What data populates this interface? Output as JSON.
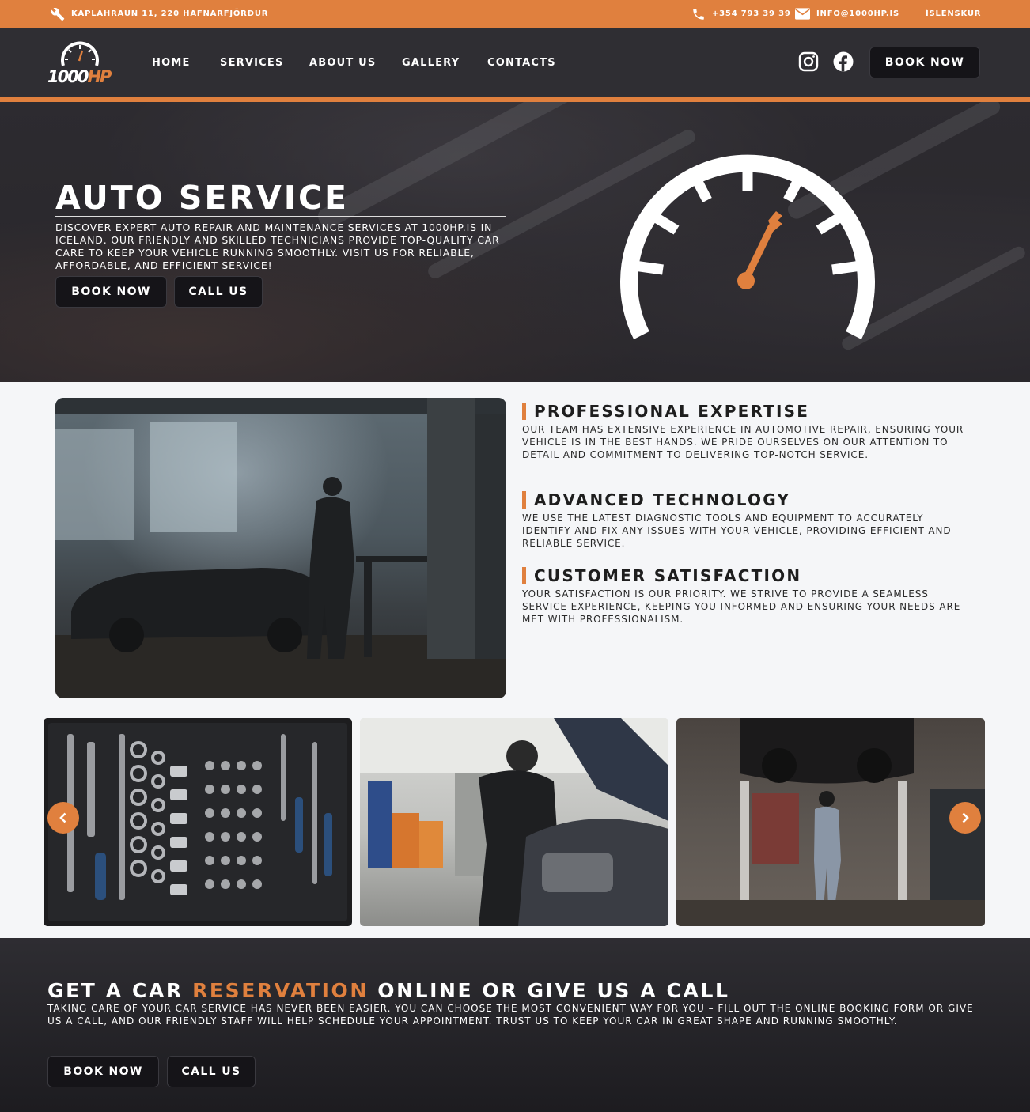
{
  "topbar": {
    "address": "KAPLAHRAUN 11, 220 HAFNARFJÖRÐUR",
    "phone": "+354 793 39 39",
    "email": "INFO@1000HP.IS",
    "language": "ÍSLENSKUR"
  },
  "logo": {
    "number": "1000",
    "suffix": "HP"
  },
  "nav": {
    "items": [
      "HOME",
      "SERVICES",
      "ABOUT US",
      "GALLERY",
      "CONTACTS"
    ],
    "book_now": "BOOK NOW",
    "social": [
      "instagram-icon",
      "facebook-icon"
    ]
  },
  "hero": {
    "title": "AUTO SERVICE",
    "text": "DISCOVER EXPERT AUTO REPAIR AND MAINTENANCE SERVICES AT 1000HP.IS IN ICELAND. OUR FRIENDLY AND SKILLED TECHNICIANS PROVIDE TOP-QUALITY CAR CARE TO KEEP YOUR VEHICLE RUNNING SMOOTHLY. VISIT US FOR RELIABLE, AFFORDABLE, AND EFFICIENT SERVICE!",
    "book_now": "BOOK NOW",
    "call_us": "CALL US"
  },
  "features": [
    {
      "title": "PROFESSIONAL EXPERTISE",
      "text": "OUR TEAM HAS EXTENSIVE EXPERIENCE IN AUTOMOTIVE REPAIR, ENSURING YOUR VEHICLE IS IN THE BEST HANDS. WE PRIDE OURSELVES ON OUR ATTENTION TO DETAIL AND COMMITMENT TO DELIVERING TOP-NOTCH SERVICE."
    },
    {
      "title": "ADVANCED TECHNOLOGY",
      "text": "WE USE THE LATEST DIAGNOSTIC TOOLS AND EQUIPMENT TO ACCURATELY IDENTIFY AND FIX ANY ISSUES WITH YOUR VEHICLE, PROVIDING EFFICIENT AND RELIABLE SERVICE."
    },
    {
      "title": "CUSTOMER SATISFACTION",
      "text": "YOUR SATISFACTION IS OUR PRIORITY. WE STRIVE TO PROVIDE A SEAMLESS SERVICE EXPERIENCE, KEEPING YOU INFORMED AND ENSURING YOUR NEEDS ARE MET WITH PROFESSIONALISM."
    }
  ],
  "cta": {
    "title_before": "GET A CAR ",
    "title_accent": "RESERVATION",
    "title_after": " ONLINE OR GIVE US A CALL",
    "text": "TAKING CARE OF YOUR CAR SERVICE HAS NEVER BEEN EASIER. YOU CAN CHOOSE THE MOST CONVENIENT WAY FOR YOU – FILL OUT THE ONLINE BOOKING FORM OR GIVE US A CALL, AND OUR FRIENDLY STAFF WILL HELP SCHEDULE YOUR APPOINTMENT. TRUST US TO KEEP YOUR CAR IN GREAT SHAPE AND RUNNING SMOOTHLY.",
    "book_now": "BOOK NOW",
    "call_us": "CALL US"
  },
  "colors": {
    "accent": "#e0803e",
    "dark": "#2f2e33",
    "button": "#151418"
  }
}
